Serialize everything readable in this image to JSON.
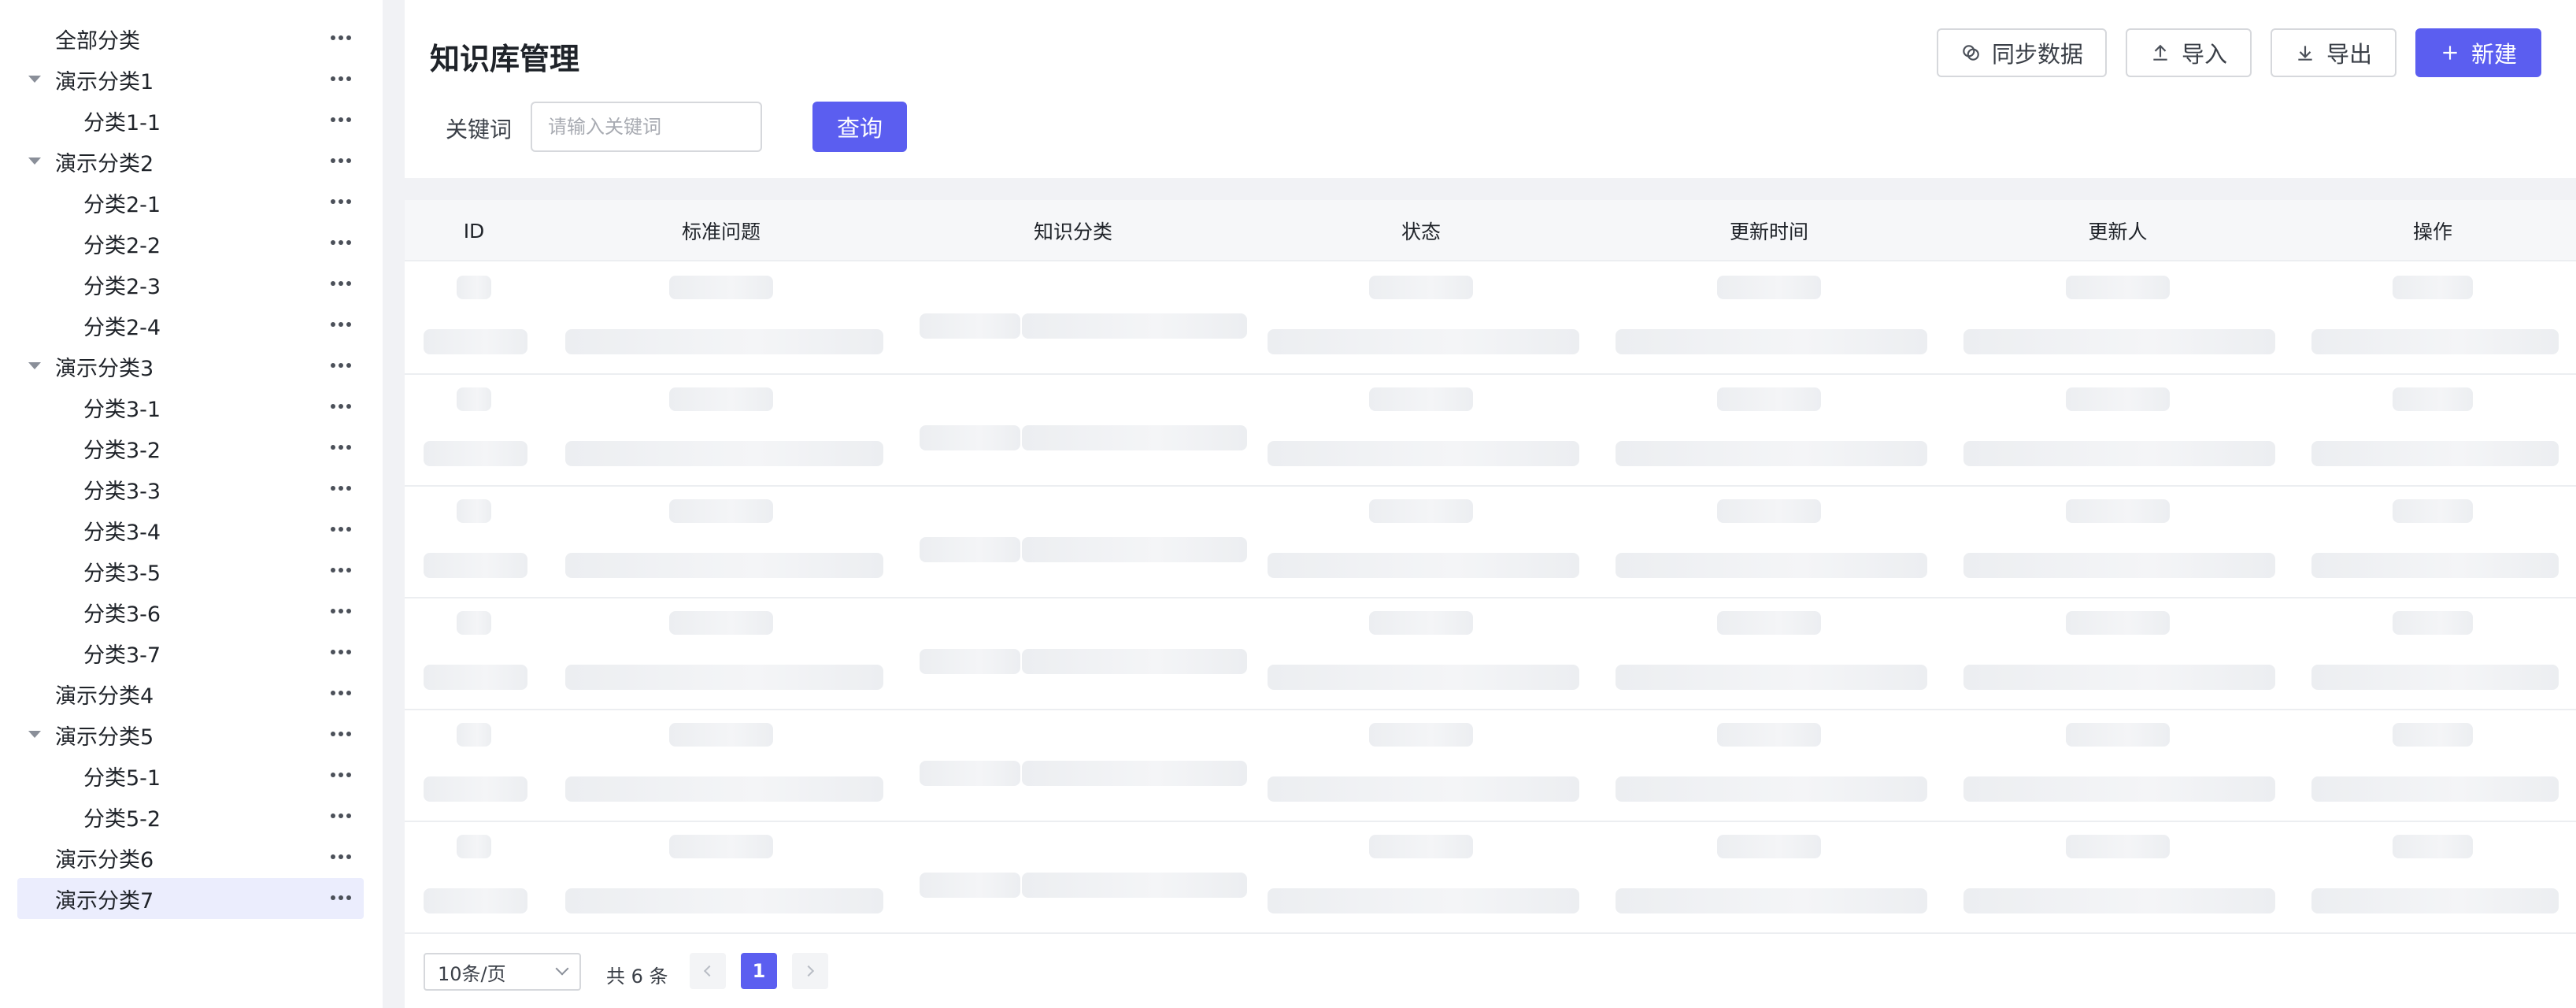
{
  "sidebar": {
    "items": [
      {
        "label": "全部分类",
        "level": 0,
        "expandable": false,
        "selected": false
      },
      {
        "label": "演示分类1",
        "level": 0,
        "expandable": true,
        "selected": false
      },
      {
        "label": "分类1-1",
        "level": 1,
        "expandable": false,
        "selected": false
      },
      {
        "label": "演示分类2",
        "level": 0,
        "expandable": true,
        "selected": false
      },
      {
        "label": "分类2-1",
        "level": 1,
        "expandable": false,
        "selected": false
      },
      {
        "label": "分类2-2",
        "level": 1,
        "expandable": false,
        "selected": false
      },
      {
        "label": "分类2-3",
        "level": 1,
        "expandable": false,
        "selected": false
      },
      {
        "label": "分类2-4",
        "level": 1,
        "expandable": false,
        "selected": false
      },
      {
        "label": "演示分类3",
        "level": 0,
        "expandable": true,
        "selected": false
      },
      {
        "label": "分类3-1",
        "level": 1,
        "expandable": false,
        "selected": false
      },
      {
        "label": "分类3-2",
        "level": 1,
        "expandable": false,
        "selected": false
      },
      {
        "label": "分类3-3",
        "level": 1,
        "expandable": false,
        "selected": false
      },
      {
        "label": "分类3-4",
        "level": 1,
        "expandable": false,
        "selected": false
      },
      {
        "label": "分类3-5",
        "level": 1,
        "expandable": false,
        "selected": false
      },
      {
        "label": "分类3-6",
        "level": 1,
        "expandable": false,
        "selected": false
      },
      {
        "label": "分类3-7",
        "level": 1,
        "expandable": false,
        "selected": false
      },
      {
        "label": "演示分类4",
        "level": 0,
        "expandable": false,
        "selected": false
      },
      {
        "label": "演示分类5",
        "level": 0,
        "expandable": true,
        "selected": false
      },
      {
        "label": "分类5-1",
        "level": 1,
        "expandable": false,
        "selected": false
      },
      {
        "label": "分类5-2",
        "level": 1,
        "expandable": false,
        "selected": false
      },
      {
        "label": "演示分类6",
        "level": 0,
        "expandable": false,
        "selected": false
      },
      {
        "label": "演示分类7",
        "level": 0,
        "expandable": false,
        "selected": true
      }
    ]
  },
  "header": {
    "title": "知识库管理",
    "buttons": {
      "sync": "同步数据",
      "import": "导入",
      "export": "导出",
      "create": "新建"
    }
  },
  "search": {
    "label": "关键词",
    "placeholder": "请输入关键词",
    "value": "",
    "query_button": "查询"
  },
  "table": {
    "columns": [
      "ID",
      "标准问题",
      "知识分类",
      "状态",
      "更新时间",
      "更新人",
      "操作"
    ],
    "loading_rows": 6
  },
  "pagination": {
    "page_size": "10条/页",
    "total": "共 6 条",
    "current_page": "1"
  },
  "colors": {
    "primary": "#5b5ef0",
    "selected_bg": "#ebedfd",
    "skeleton": "#eceef1"
  }
}
